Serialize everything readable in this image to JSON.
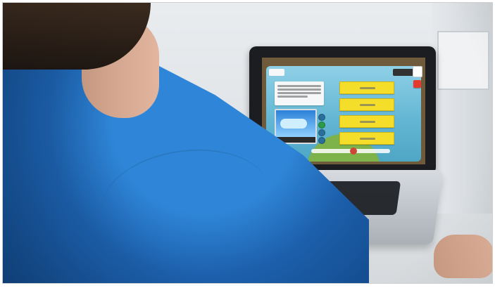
{
  "scene": {}
}
